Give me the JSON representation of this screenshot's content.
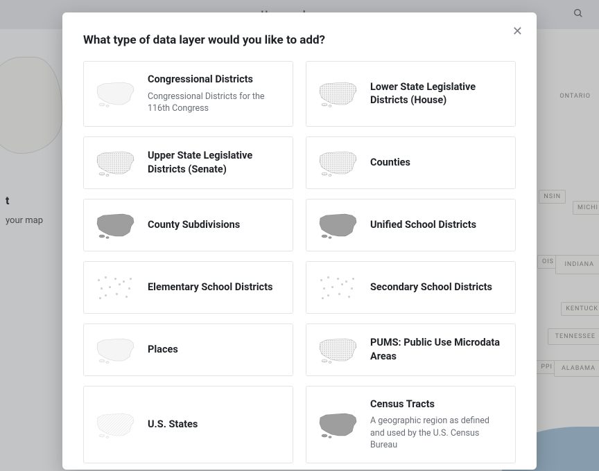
{
  "header": {
    "map_name": "Unnamed map"
  },
  "leftPanel": {
    "heading_fragment": "t",
    "subtext_fragment": "your map"
  },
  "mapLabels": {
    "ontario": "ONTARIO",
    "nsin": "NSIN",
    "michi": "MICHI",
    "ois": "OIS",
    "indiana": "INDIANA",
    "kentuck": "KENTUCK",
    "tenness": "TENNESSEE",
    "ppi": "PPI",
    "alabama": "ALABAMA"
  },
  "modal": {
    "title": "What type of data layer would you like to add?",
    "layers": [
      {
        "title": "Congressional Districts",
        "desc": "Congressional Districts for the 116th Congress",
        "thumb": "us-outline"
      },
      {
        "title": "Lower State Legislative Districts (House)",
        "desc": "",
        "thumb": "us-dense"
      },
      {
        "title": "Upper State Legislative Districts (Senate)",
        "desc": "",
        "thumb": "us-dense"
      },
      {
        "title": "Counties",
        "desc": "",
        "thumb": "us-dense"
      },
      {
        "title": "County Subdivisions",
        "desc": "",
        "thumb": "us-dark"
      },
      {
        "title": "Unified School Districts",
        "desc": "",
        "thumb": "us-dark"
      },
      {
        "title": "Elementary School Districts",
        "desc": "",
        "thumb": "sparse"
      },
      {
        "title": "Secondary School Districts",
        "desc": "",
        "thumb": "sparse"
      },
      {
        "title": "Places",
        "desc": "",
        "thumb": "us-outline"
      },
      {
        "title": "PUMS: Public Use Microdata Areas",
        "desc": "",
        "thumb": "us-dense"
      },
      {
        "title": "U.S. States",
        "desc": "",
        "thumb": "us-light"
      },
      {
        "title": "Census Tracts",
        "desc": "A geographic region as defined and used by the U.S. Census Bureau",
        "thumb": "us-dark"
      }
    ]
  }
}
